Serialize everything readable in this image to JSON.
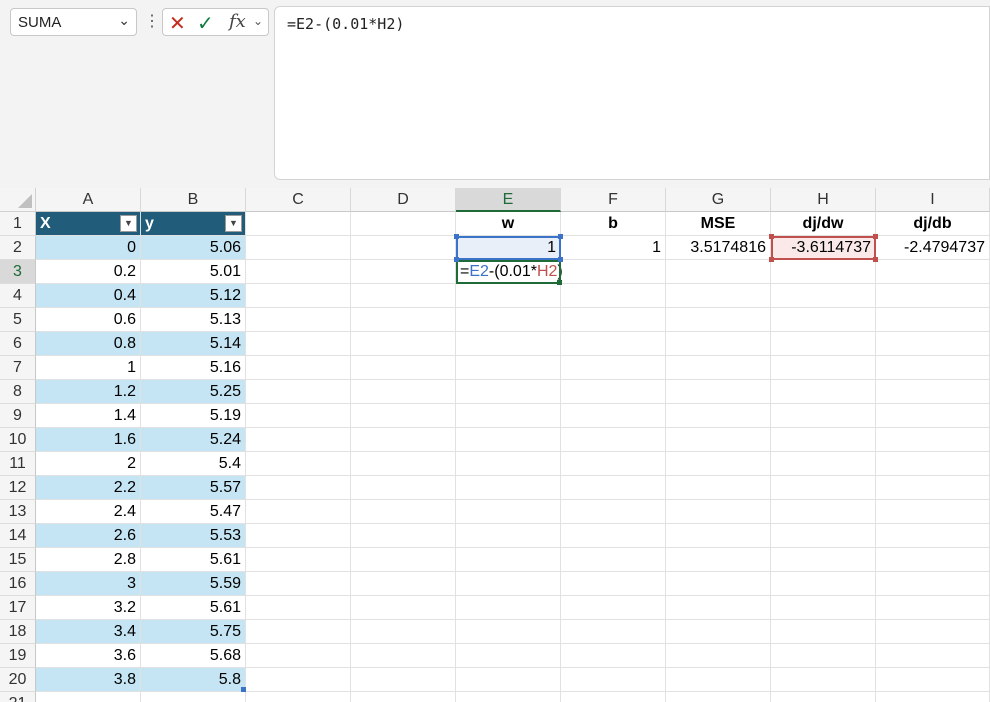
{
  "formula_bar": {
    "name_box": "SUMA",
    "fx_label": "fx",
    "formula": "=E2-(0.01*H2)"
  },
  "columns": [
    "A",
    "B",
    "C",
    "D",
    "E",
    "F",
    "G",
    "H",
    "I"
  ],
  "rows": [
    "1",
    "2",
    "3",
    "4",
    "5",
    "6",
    "7",
    "8",
    "9",
    "10",
    "11",
    "12",
    "13",
    "14",
    "15",
    "16",
    "17",
    "18",
    "19",
    "20",
    "21"
  ],
  "table": {
    "headers": [
      "X",
      "y"
    ],
    "x_values": [
      "0",
      "0.2",
      "0.4",
      "0.6",
      "0.8",
      "1",
      "1.2",
      "1.4",
      "1.6",
      "2",
      "2.2",
      "2.4",
      "2.6",
      "2.8",
      "3",
      "3.2",
      "3.4",
      "3.6",
      "3.8"
    ],
    "y_values": [
      "5.06",
      "5.01",
      "5.12",
      "5.13",
      "5.14",
      "5.16",
      "5.25",
      "5.19",
      "5.24",
      "5.4",
      "5.57",
      "5.47",
      "5.53",
      "5.61",
      "5.59",
      "5.61",
      "5.75",
      "5.68",
      "5.8"
    ]
  },
  "params": {
    "headers": {
      "E": "w",
      "F": "b",
      "G": "MSE",
      "H": "dj/dw",
      "I": "dj/db"
    },
    "values": {
      "E": "1",
      "F": "1",
      "G": "3.5174816",
      "H": "-3.6114737",
      "I": "-2.4794737"
    }
  },
  "edit_cell": {
    "prefix": "=",
    "ref1": "E2",
    "middle": "-(0.01*",
    "ref2": "H2",
    "suffix": ")"
  },
  "colors": {
    "table_header": "#215c7a",
    "band": "#c5e5f4",
    "ref_blue": "#3b73c9",
    "ref_red": "#c0504d",
    "active_green": "#1e6b37"
  }
}
